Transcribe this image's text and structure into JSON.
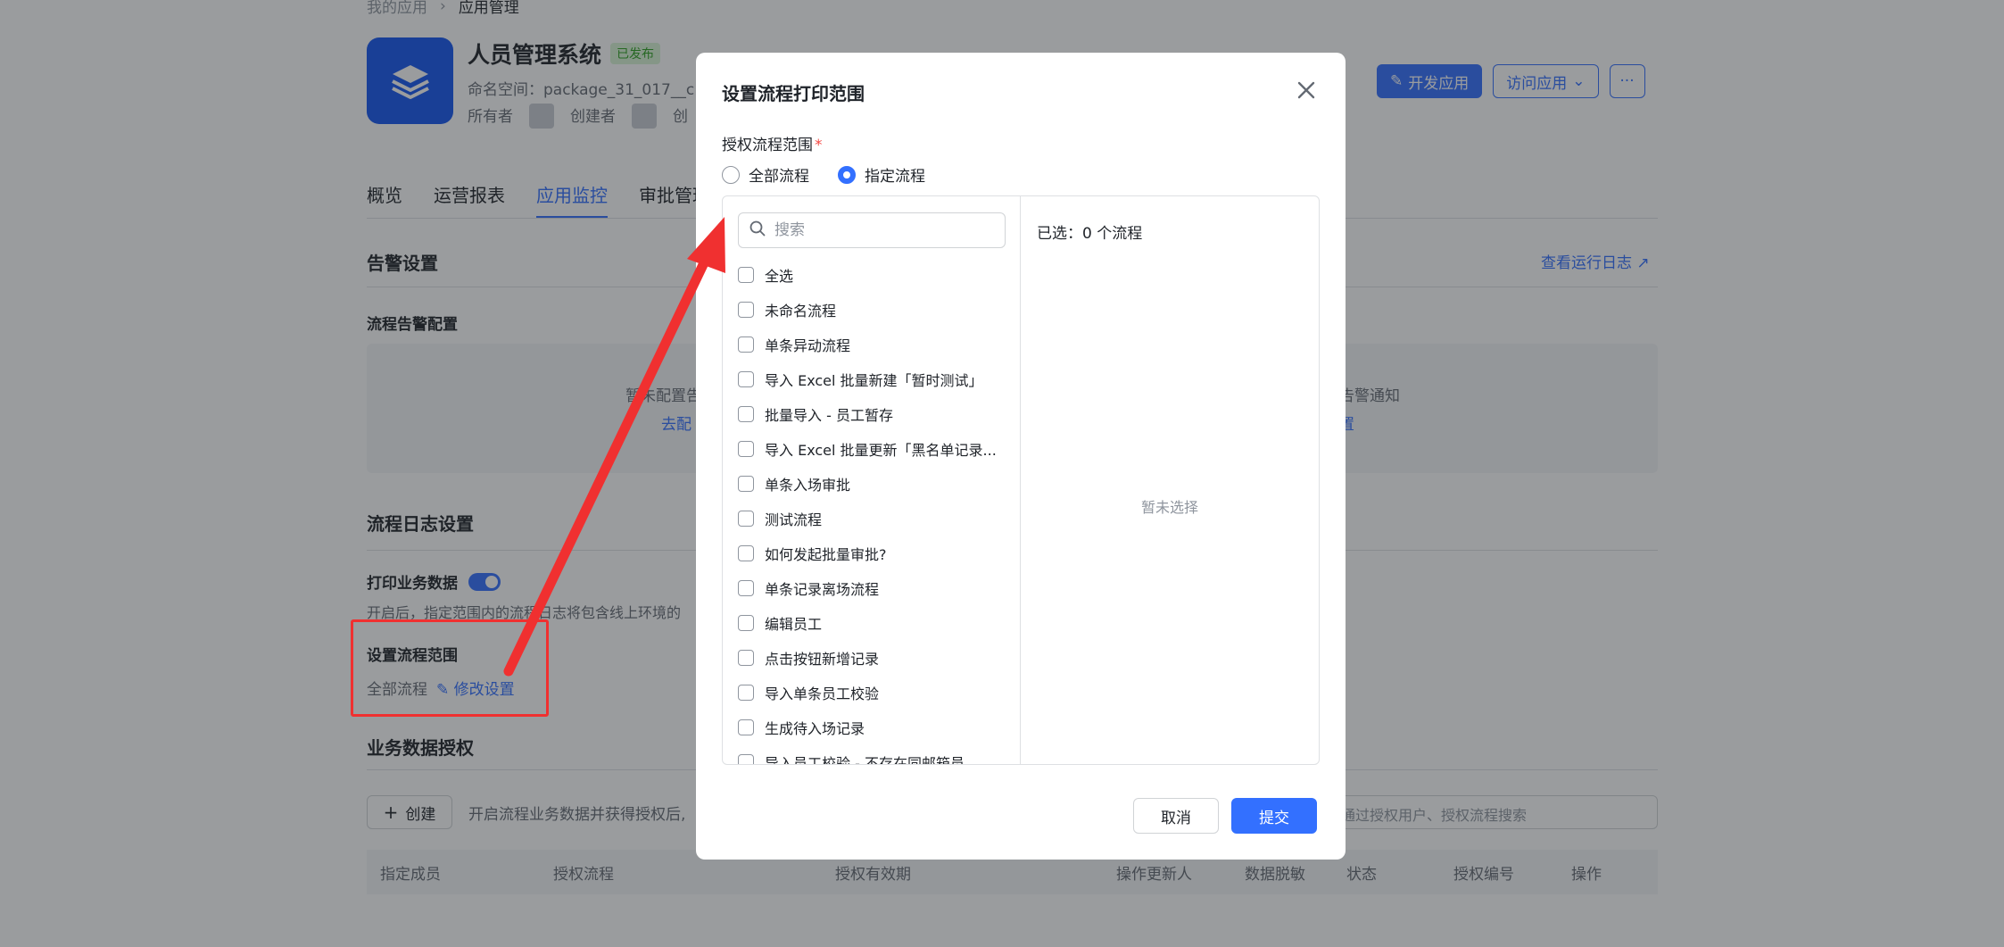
{
  "breadcrumb": {
    "parent": "我的应用",
    "current": "应用管理"
  },
  "app": {
    "title": "人员管理系统",
    "status_badge": "已发布",
    "namespace": "命名空间：package_31_017__c",
    "owner_label": "所有者",
    "creator_label": "创建者",
    "extra_label": "创"
  },
  "header_buttons": {
    "develop": "开发应用",
    "visit": "访问应用",
    "more": "···"
  },
  "tabs": [
    "概览",
    "运营报表",
    "应用监控",
    "审批管理"
  ],
  "alert": {
    "title": "告警设置",
    "view_logs": "查看运行日志",
    "flow_config_title": "流程告警配置",
    "left_text": "暂未配置告",
    "left_link": "去配",
    "right_text": "告警通知",
    "right_link": "置"
  },
  "log_settings": {
    "title": "流程日志设置",
    "print_label": "打印业务数据",
    "print_desc": "开启后，指定范围内的流程日志将包含线上环境的",
    "range_title": "设置流程范围",
    "range_value": "全部流程",
    "edit_link": "修改设置"
  },
  "biz_auth": {
    "title": "业务数据授权",
    "create_btn": "创建",
    "desc": "开启流程业务数据并获得授权后,",
    "search_placeholder": "通过授权用户、授权流程搜索",
    "columns": [
      "指定成员",
      "授权流程",
      "授权有效期",
      "操作更新人",
      "数据脱敏",
      "状态",
      "授权编号",
      "操作"
    ]
  },
  "modal": {
    "title": "设置流程打印范围",
    "field_label": "授权流程范围",
    "required_mark": "*",
    "radio_all": "全部流程",
    "radio_specified": "指定流程",
    "search_placeholder": "搜索",
    "items": [
      "全选",
      "未命名流程",
      "单条异动流程",
      "导入 Excel 批量新建「暂时测试」",
      "批量导入 - 员工暂存",
      "导入 Excel 批量更新「黑名单记录...",
      "单条入场审批",
      "测试流程",
      "如何发起批量审批?",
      "单条记录离场流程",
      "编辑员工",
      "点击按钮新增记录",
      "导入单条员工校验",
      "生成待入场记录",
      "导入员工校验 - 不存在同邮箱员..."
    ],
    "selected_count": "已选：0 个流程",
    "empty_tip": "暂未选择",
    "cancel": "取消",
    "submit": "提交"
  },
  "colors": {
    "primary": "#3370ff",
    "annotation_red": "#f03030",
    "overlay": "rgba(31,35,41,0.45)"
  }
}
